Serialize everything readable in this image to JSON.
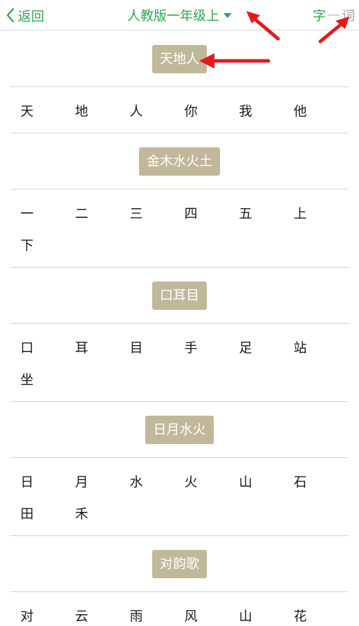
{
  "nav": {
    "back_label": "返回",
    "title": "人教版一年级上",
    "toggle_char": "字",
    "toggle_sep": "—",
    "toggle_word": "词"
  },
  "colors": {
    "accent_green": "#2fa84f",
    "badge_bg": "#c1b89a",
    "annotation_red": "#e41a1a"
  },
  "sections": [
    {
      "title": "天地人",
      "chars": [
        "天",
        "地",
        "人",
        "你",
        "我",
        "他"
      ]
    },
    {
      "title": "金木水火土",
      "chars": [
        "一",
        "二",
        "三",
        "四",
        "五",
        "上",
        "下"
      ]
    },
    {
      "title": "口耳目",
      "chars": [
        "口",
        "耳",
        "目",
        "手",
        "足",
        "站",
        "坐"
      ]
    },
    {
      "title": "日月水火",
      "chars": [
        "日",
        "月",
        "水",
        "火",
        "山",
        "石",
        "田",
        "禾"
      ]
    },
    {
      "title": "对韵歌",
      "chars": [
        "对",
        "云",
        "雨",
        "风",
        "山",
        "花"
      ]
    }
  ]
}
